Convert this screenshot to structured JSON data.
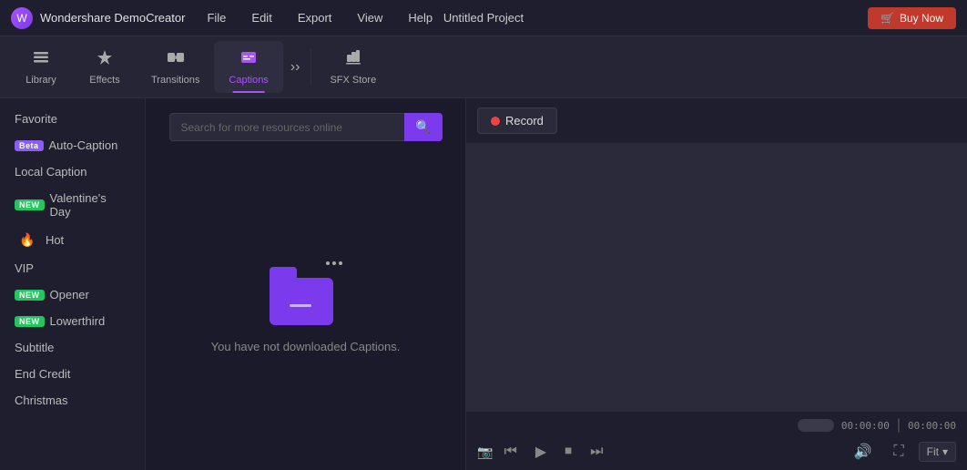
{
  "app": {
    "name": "Wondershare DemoCreator",
    "project_title": "Untitled Project"
  },
  "menu": {
    "items": [
      "File",
      "Edit",
      "Export",
      "View",
      "Help"
    ]
  },
  "buy_now": {
    "label": "Buy Now"
  },
  "toolbar": {
    "tabs": [
      {
        "id": "library",
        "label": "Library",
        "icon": "☰",
        "active": false
      },
      {
        "id": "effects",
        "label": "Effects",
        "icon": "✨",
        "active": false
      },
      {
        "id": "transitions",
        "label": "Transitions",
        "icon": "⇄",
        "active": false
      },
      {
        "id": "captions",
        "label": "Captions",
        "icon": "💬",
        "active": true
      },
      {
        "id": "sfx-store",
        "label": "SFX Store",
        "icon": "🎵",
        "active": false
      }
    ]
  },
  "sidebar": {
    "items": [
      {
        "id": "favorite",
        "label": "Favorite",
        "badge": null
      },
      {
        "id": "auto-caption",
        "label": "Auto-Caption",
        "badge": "Beta",
        "badge_type": "beta"
      },
      {
        "id": "local-caption",
        "label": "Local Caption",
        "badge": null
      },
      {
        "id": "valentines-day",
        "label": "Valentine's Day",
        "badge": "NEW",
        "badge_type": "new"
      },
      {
        "id": "hot",
        "label": "Hot",
        "badge": "🔥",
        "badge_type": "hot"
      },
      {
        "id": "vip",
        "label": "VIP",
        "badge": null
      },
      {
        "id": "opener",
        "label": "Opener",
        "badge": "NEW",
        "badge_type": "new"
      },
      {
        "id": "lowerthird",
        "label": "Lowerthird",
        "badge": "NEW",
        "badge_type": "new"
      },
      {
        "id": "subtitle",
        "label": "Subtitle",
        "badge": null
      },
      {
        "id": "end-credit",
        "label": "End Credit",
        "badge": null
      },
      {
        "id": "christmas",
        "label": "Christmas",
        "badge": null
      }
    ]
  },
  "search": {
    "placeholder": "Search for more resources online"
  },
  "empty_state": {
    "message": "You have not downloaded Captions."
  },
  "record": {
    "label": "Record"
  },
  "preview": {
    "time_current": "00:00:00",
    "time_total": "00:00:00",
    "fit_label": "Fit"
  }
}
